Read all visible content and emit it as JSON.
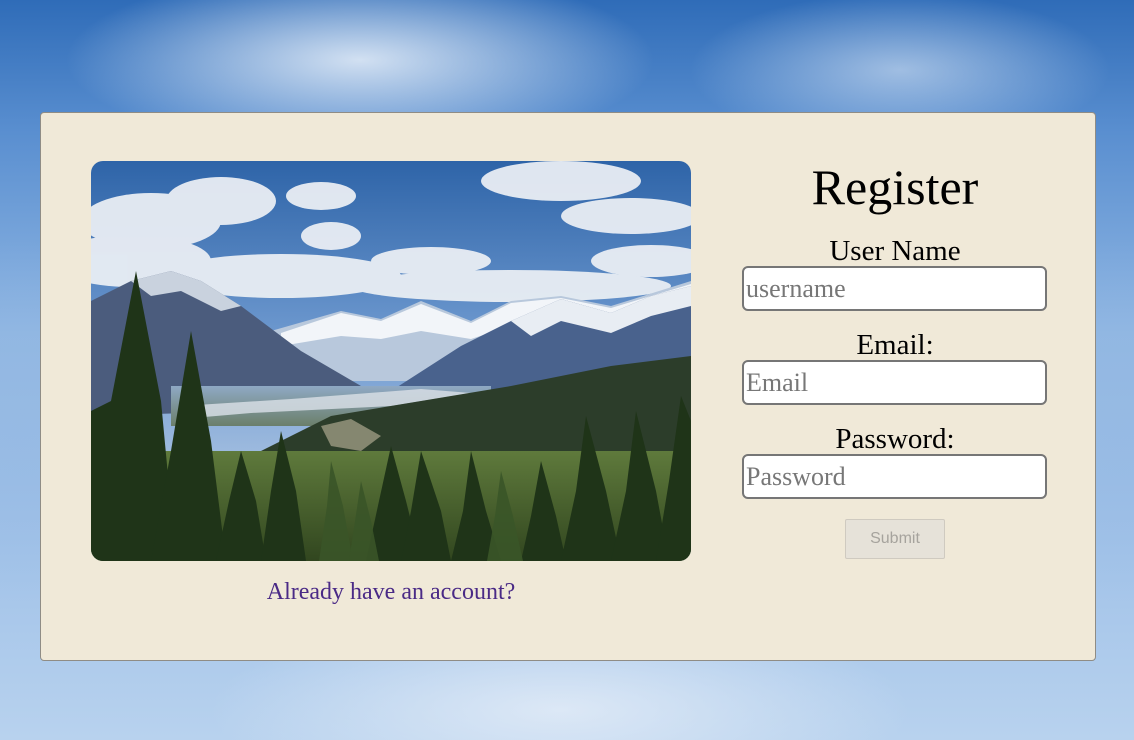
{
  "register": {
    "title": "Register",
    "username": {
      "label": "User Name",
      "placeholder": "username",
      "value": ""
    },
    "email": {
      "label": "Email:",
      "placeholder": "Email",
      "value": ""
    },
    "password": {
      "label": "Password:",
      "placeholder": "Password",
      "value": ""
    },
    "submit_label": "Submit"
  },
  "login_link": "Already have an account?",
  "colors": {
    "card_background": "#f0e9d8",
    "link": "#4a2a86",
    "submit_disabled_text": "#a6a39d"
  }
}
